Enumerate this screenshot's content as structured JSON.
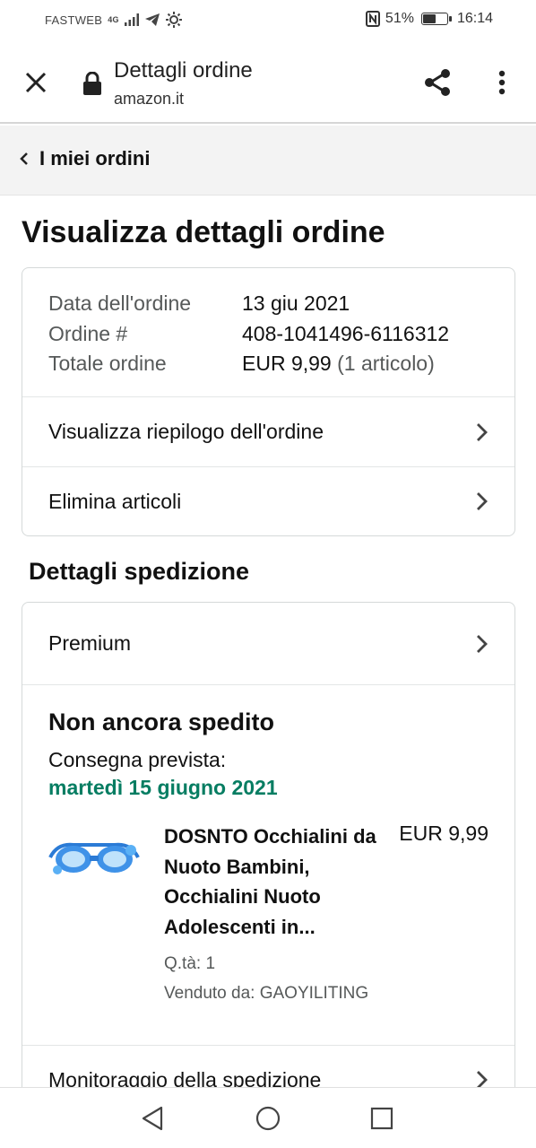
{
  "status_bar": {
    "carrier": "FASTWEB",
    "network": "4G",
    "battery_percent": "51%",
    "battery_level": 0.51,
    "time": "16:14"
  },
  "toolbar": {
    "title": "Dettagli ordine",
    "url": "amazon.it",
    "icons": [
      "close-icon",
      "lock-icon",
      "share-icon",
      "more-vert-icon"
    ]
  },
  "breadcrumb": {
    "label": "I miei ordini"
  },
  "page_title": "Visualizza dettagli ordine",
  "order_summary": {
    "date_label": "Data dell'ordine",
    "date_value": "13 giu 2021",
    "number_label": "Ordine #",
    "number_value": "408-1041496-6116312",
    "total_label": "Totale ordine",
    "total_value": "EUR 9,99",
    "total_items": "(1 articolo)"
  },
  "order_actions": [
    {
      "label": "Visualizza riepilogo dell'ordine"
    },
    {
      "label": "Elimina articoli"
    }
  ],
  "shipping": {
    "section_title": "Dettagli spedizione",
    "method": "Premium",
    "status": "Non ancora spedito",
    "delivery_label": "Consegna prevista:",
    "delivery_date": "martedì 15 giugno 2021",
    "item": {
      "title": "DOSNTO Occhialini da Nuoto Bambini, Occhialini Nuoto Adolescenti in...",
      "price": "EUR 9,99",
      "quantity": "Q.tà: 1",
      "seller": "Venduto da: GAOYILITING"
    },
    "tracking_label": "Monitoraggio della spedizione"
  },
  "colors": {
    "delivery_green": "#067d62",
    "muted_text": "#565959",
    "border": "#d5d9d9",
    "band_bg": "#f3f3f3"
  }
}
